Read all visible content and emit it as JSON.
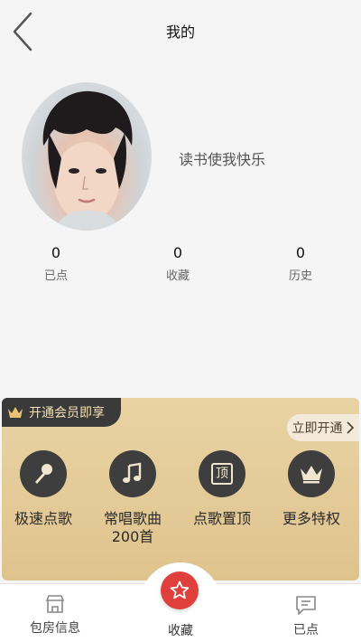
{
  "header": {
    "title": "我的",
    "back_icon": "chevron-left-icon"
  },
  "profile": {
    "nickname": "读书使我快乐"
  },
  "stats": [
    {
      "value": "0",
      "label": "已点"
    },
    {
      "value": "0",
      "label": "收藏"
    },
    {
      "value": "0",
      "label": "历史"
    }
  ],
  "vip": {
    "banner_label": "开通会员即享",
    "open_button_label": "立即开通",
    "perks": [
      {
        "icon": "microphone-icon",
        "label": "极速点歌"
      },
      {
        "icon": "music-note-icon",
        "label": "常唱歌曲\n200首"
      },
      {
        "icon": "pin-top-icon",
        "glyph": "顶",
        "label": "点歌置顶"
      },
      {
        "icon": "crown-icon",
        "label": "更多特权"
      }
    ]
  },
  "tabbar": {
    "items": [
      {
        "icon": "store-icon",
        "label": "包房信息"
      },
      {
        "icon": "star-icon",
        "label": "收藏"
      },
      {
        "icon": "message-icon",
        "label": "已点"
      }
    ]
  },
  "colors": {
    "accent_red": "#e0403c",
    "vip_gold": "#e6cd9b",
    "vip_dark": "#3a3a3a"
  }
}
